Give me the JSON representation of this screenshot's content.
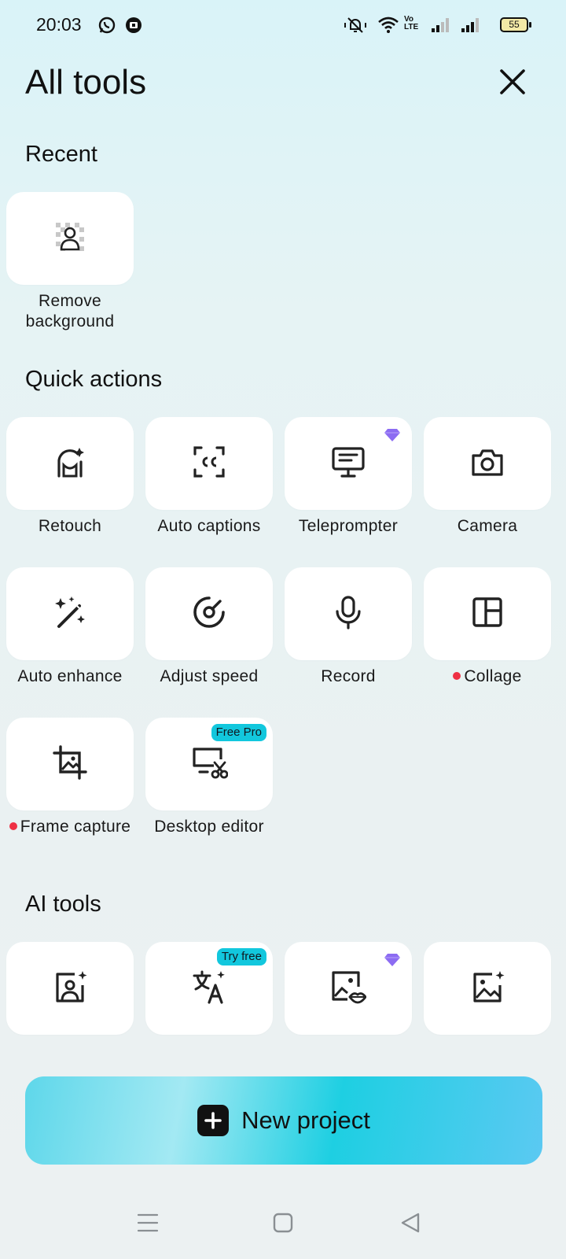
{
  "status_bar": {
    "time": "20:03",
    "battery": "55",
    "icons": [
      "whatsapp-icon",
      "notification-icon",
      "mute-icon",
      "wifi-icon",
      "volte-icon",
      "signal-icon",
      "signal-icon",
      "battery-icon"
    ]
  },
  "header": {
    "title": "All tools",
    "close_icon": "close-icon"
  },
  "recent": {
    "title": "Recent",
    "items": [
      {
        "label": "Remove background",
        "icon": "remove-background-icon"
      }
    ]
  },
  "quick_actions": {
    "title": "Quick actions",
    "items": [
      {
        "label": "Retouch",
        "icon": "retouch-icon"
      },
      {
        "label": "Auto captions",
        "icon": "captions-icon"
      },
      {
        "label": "Teleprompter",
        "icon": "teleprompter-icon",
        "premium": true
      },
      {
        "label": "Camera",
        "icon": "camera-icon"
      },
      {
        "label": "Auto enhance",
        "icon": "magic-wand-icon"
      },
      {
        "label": "Adjust speed",
        "icon": "speed-icon"
      },
      {
        "label": "Record",
        "icon": "microphone-icon"
      },
      {
        "label": "Collage",
        "icon": "collage-icon",
        "new_dot": true
      },
      {
        "label": "Frame capture",
        "icon": "frame-capture-icon",
        "new_dot": true
      },
      {
        "label": "Desktop editor",
        "icon": "desktop-editor-icon",
        "badge": "Free Pro"
      }
    ]
  },
  "ai_tools": {
    "title": "AI tools",
    "items": [
      {
        "icon": "ai-portrait-icon"
      },
      {
        "icon": "translate-icon",
        "badge": "Try free"
      },
      {
        "icon": "lip-sync-icon",
        "premium": true
      },
      {
        "icon": "ai-image-icon"
      }
    ]
  },
  "new_project": {
    "label": "New project",
    "icon": "plus-icon"
  },
  "nav_bar": {
    "icons": [
      "menu-icon",
      "home-icon",
      "back-icon"
    ]
  },
  "colors": {
    "accent": "#12c7dd",
    "premium": "#8c6cf2",
    "new_dot": "#ef3044"
  }
}
